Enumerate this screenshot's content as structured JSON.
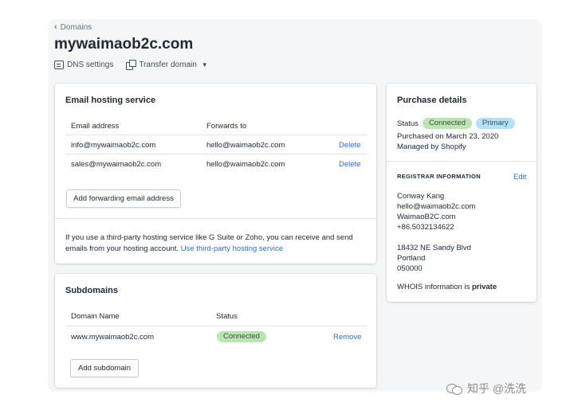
{
  "nav": {
    "back_label": "Domains"
  },
  "page": {
    "title": "mywaimaob2c.com"
  },
  "actions": {
    "dns_settings": "DNS settings",
    "transfer_domain": "Transfer domain"
  },
  "email_card": {
    "title": "Email hosting service",
    "col_email": "Email address",
    "col_forwards": "Forwards to",
    "rows": [
      {
        "email": "info@mywaimaob2c.com",
        "forwards": "hello@waimaob2c.com",
        "action": "Delete"
      },
      {
        "email": "sales@mywaimaob2c.com",
        "forwards": "hello@waimaob2c.com",
        "action": "Delete"
      }
    ],
    "add_button": "Add forwarding email address",
    "note_text": "If you use a third-party hosting service like G Suite or Zoho, you can receive and send emails from your hosting account.",
    "note_link": "Use third-party hosting service"
  },
  "subdomains_card": {
    "title": "Subdomains",
    "col_domain": "Domain Name",
    "col_status": "Status",
    "rows": [
      {
        "domain": "www.mywaimaob2c.com",
        "status": "Connected",
        "action": "Remove"
      }
    ],
    "add_button": "Add subdomain"
  },
  "purchase_card": {
    "title": "Purchase details",
    "status_label": "Status",
    "badge_connected": "Connected",
    "badge_primary": "Primary",
    "purchased_on": "Purchased on March 23, 2020",
    "managed_by": "Managed by Shopify",
    "registrar_heading": "REGISTRAR INFORMATION",
    "edit_label": "Edit",
    "contact_name": "Conway Kang",
    "contact_email": "hello@waimaob2c.com",
    "contact_company": "WaimaoB2C.com",
    "contact_phone": "+86.5032134622",
    "address_line1": "18432 NE Sandy Blvd",
    "address_city": "Portland",
    "address_zip": "050000",
    "whois_prefix": "WHOIS information is",
    "whois_value": "private"
  },
  "watermark": {
    "text": "知乎 @洗洗"
  },
  "colors": {
    "link": "#2c6ecb",
    "badge_green": "#bbe5b3",
    "badge_blue": "#b4e1fa"
  }
}
